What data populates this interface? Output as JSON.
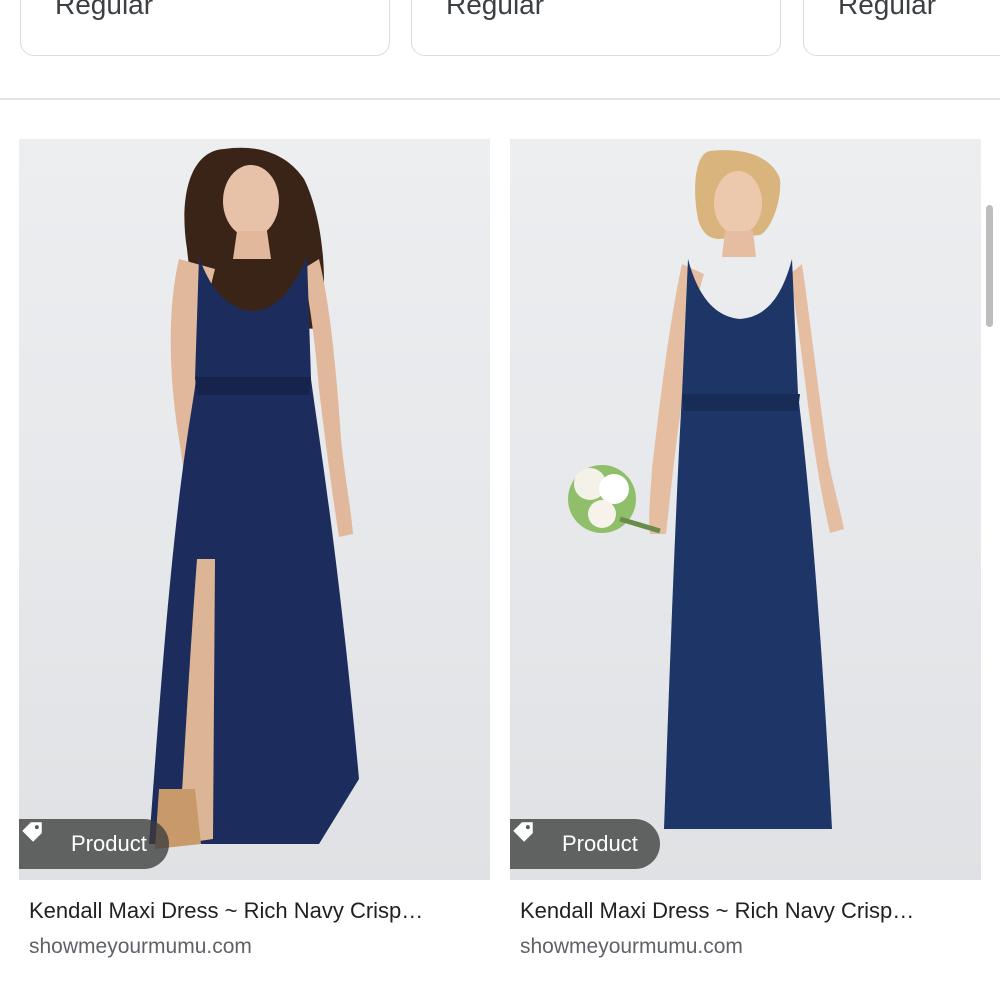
{
  "chips": [
    {
      "label": "Regular"
    },
    {
      "label": "Regular"
    },
    {
      "label": "Regular"
    }
  ],
  "results": [
    {
      "badge": "Product",
      "title": "Kendall Maxi Dress ~ Rich Navy Crisp…",
      "source": "showmeyourmumu.com"
    },
    {
      "badge": "Product",
      "title": "Kendall Maxi Dress ~ Rich Navy Crisp…",
      "source": "showmeyourmumu.com"
    }
  ],
  "colors": {
    "dress": "#1c2c5c",
    "badge_bg": "#3c3c3c",
    "source_text": "#5f6368"
  }
}
